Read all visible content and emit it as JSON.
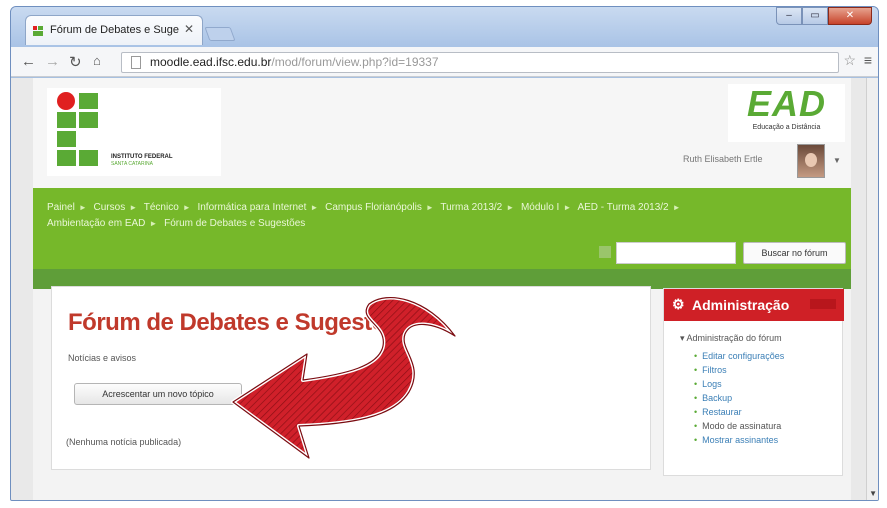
{
  "browser": {
    "tab_title": "Fórum de Debates e Suge",
    "url_host": "moodle.ead.ifsc.edu.br",
    "url_path": "/mod/forum/view.php?id=19337"
  },
  "header": {
    "logo_title": "INSTITUTO FEDERAL",
    "logo_sub": "SANTA CATARINA",
    "ead_big": "EAD",
    "ead_sub": "Educação a Distância",
    "user_name": "Ruth Elisabeth Ertle"
  },
  "breadcrumbs": [
    "Painel",
    "Cursos",
    "Técnico",
    "Informática para Internet",
    "Campus Florianópolis",
    "Turma 2013/2",
    "Módulo I",
    "AED - Turma 2013/2",
    "Ambientação em EAD",
    "Fórum de Debates e Sugestões"
  ],
  "search": {
    "button_label": "Buscar no fórum"
  },
  "main": {
    "title": "Fórum de Debates e Sugestões",
    "news_label": "Notícias e avisos",
    "add_button": "Acrescentar um novo tópico",
    "empty_text": "(Nenhuma notícia publicada)"
  },
  "admin": {
    "title": "Administração",
    "root_item": "Administração do fórum",
    "items": [
      "Editar configurações",
      "Filtros",
      "Logs",
      "Backup",
      "Restaurar",
      "Modo de assinatura",
      "Mostrar assinantes"
    ]
  },
  "colors": {
    "brand_green": "#76b82a",
    "admin_red": "#cf2026",
    "title_red": "#c0392b"
  }
}
